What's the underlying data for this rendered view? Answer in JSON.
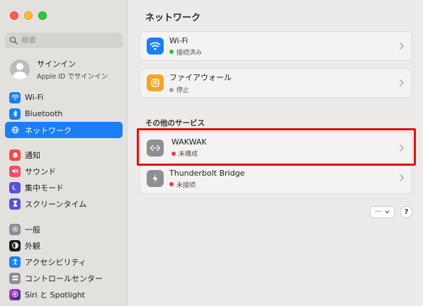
{
  "sidebar": {
    "search_placeholder": "検索",
    "account": {
      "name": "サインイン",
      "sub": "Apple ID でサインイン"
    },
    "items": [
      {
        "label": "Wi-Fi"
      },
      {
        "label": "Bluetooth"
      },
      {
        "label": "ネットワーク"
      },
      {
        "label": "通知"
      },
      {
        "label": "サウンド"
      },
      {
        "label": "集中モード"
      },
      {
        "label": "スクリーンタイム"
      },
      {
        "label": "一般"
      },
      {
        "label": "外観"
      },
      {
        "label": "アクセシビリティ"
      },
      {
        "label": "コントロールセンター"
      },
      {
        "label": "Siri と Spotlight"
      }
    ],
    "active_index": 2
  },
  "main": {
    "title": "ネットワーク",
    "services": [
      {
        "title": "Wi-Fi",
        "status": "接続済み",
        "status_color": "#29c240"
      },
      {
        "title": "ファイアウォール",
        "status": "停止",
        "status_color": "#a0a0a0"
      }
    ],
    "other_section_label": "その他のサービス",
    "other_services": [
      {
        "title": "WAKWAK",
        "status": "未構成",
        "status_color": "#f03e3e"
      },
      {
        "title": "Thunderbolt Bridge",
        "status": "未接続",
        "status_color": "#f03e3e"
      }
    ],
    "more_button_label": "···",
    "help_button_label": "?"
  },
  "colors": {
    "accent": "#1a7ff4",
    "highlight": "#e01010"
  }
}
